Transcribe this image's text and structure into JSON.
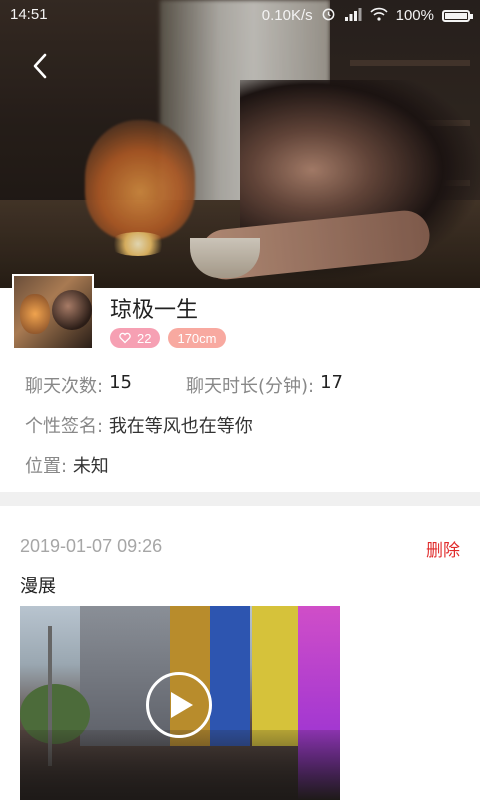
{
  "status_bar": {
    "time": "14:51",
    "network_speed": "0.10K/s",
    "battery_percent": "100%",
    "battery_level": 1.0
  },
  "header": {
    "back_icon": "chevron-left-icon"
  },
  "profile": {
    "name": "琼极一生",
    "badges": {
      "heart_count": "22",
      "height": "170cm"
    },
    "stats": {
      "chat_count_label": "聊天次数:",
      "chat_count_value": "15",
      "chat_duration_label": "聊天时长(分钟):",
      "chat_duration_value": "17"
    },
    "signature_label": "个性签名:",
    "signature_value": "我在等风也在等你",
    "location_label": "位置:",
    "location_value": "未知"
  },
  "post": {
    "date": "2019-01-07 09:26",
    "delete_label": "删除",
    "caption": "漫展",
    "media_icon": "play-icon"
  },
  "colors": {
    "delete": "#e02b2b",
    "badge_heart": "#f6a0b3",
    "badge_height": "#f8a9a0",
    "divider": "#f0f0f0"
  }
}
